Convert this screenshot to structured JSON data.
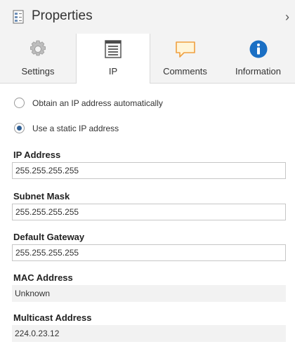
{
  "header": {
    "title": "Properties",
    "collapse_glyph": "›",
    "icons": {
      "title": "properties-page-icon",
      "collapse": "chevron-right-icon"
    }
  },
  "tabs": [
    {
      "label": "Settings",
      "icon": "gear-icon",
      "active": false
    },
    {
      "label": "IP",
      "icon": "network-config-icon",
      "active": true
    },
    {
      "label": "Comments",
      "icon": "comment-icon",
      "active": false
    },
    {
      "label": "Information",
      "icon": "info-icon",
      "active": false
    }
  ],
  "ip_mode": {
    "options": [
      {
        "label": "Obtain an IP address automatically",
        "checked": false
      },
      {
        "label": "Use a static IP address",
        "checked": true
      }
    ]
  },
  "fields": {
    "ip_address": {
      "label": "IP Address",
      "value": "255.255.255.255"
    },
    "subnet_mask": {
      "label": "Subnet Mask",
      "value": "255.255.255.255"
    },
    "default_gateway": {
      "label": "Default Gateway",
      "value": "255.255.255.255"
    },
    "mac_address": {
      "label": "MAC Address",
      "value": "Unknown"
    },
    "multicast_address": {
      "label": "Multicast Address",
      "value": "224.0.23.12"
    }
  },
  "colors": {
    "radio_selected": "#2f5f95",
    "info_blue": "#1a6fc4",
    "comment_orange": "#f0a040",
    "panel_background": "#f3f3f3"
  }
}
